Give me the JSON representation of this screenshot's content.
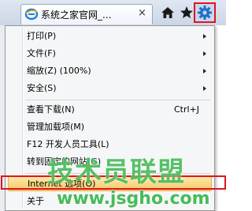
{
  "browser": {
    "tab_title": "系统之家官网_...",
    "tab_close": "×"
  },
  "toolbar": {
    "home": "home",
    "favorites": "favorites",
    "tools": "tools"
  },
  "menu": {
    "items": [
      {
        "label": "打印(P)",
        "shortcut": "",
        "submenu": true
      },
      {
        "label": "文件(F)",
        "shortcut": "",
        "submenu": true
      },
      {
        "label": "缩放(Z) (100%)",
        "shortcut": "",
        "submenu": true
      },
      {
        "label": "安全(S)",
        "shortcut": "",
        "submenu": true
      },
      {
        "label": "查看下载(N)",
        "shortcut": "Ctrl+J",
        "submenu": false
      },
      {
        "label": "管理加载项(M)",
        "shortcut": "",
        "submenu": false
      },
      {
        "label": "F12 开发人员工具(L)",
        "shortcut": "",
        "submenu": false
      },
      {
        "label": "转到固定的网站(G)",
        "shortcut": "",
        "submenu": false
      },
      {
        "label": "Internet 选项(O)",
        "shortcut": "",
        "submenu": false,
        "highlighted": true
      },
      {
        "label": "关于",
        "shortcut": "",
        "submenu": false
      }
    ]
  },
  "watermark": {
    "title": "技术员联盟",
    "url": "www.jsgho.com"
  },
  "colors": {
    "highlight_box": "#e0151d",
    "watermark": "#28af3c",
    "hover": "#f6c96a"
  }
}
